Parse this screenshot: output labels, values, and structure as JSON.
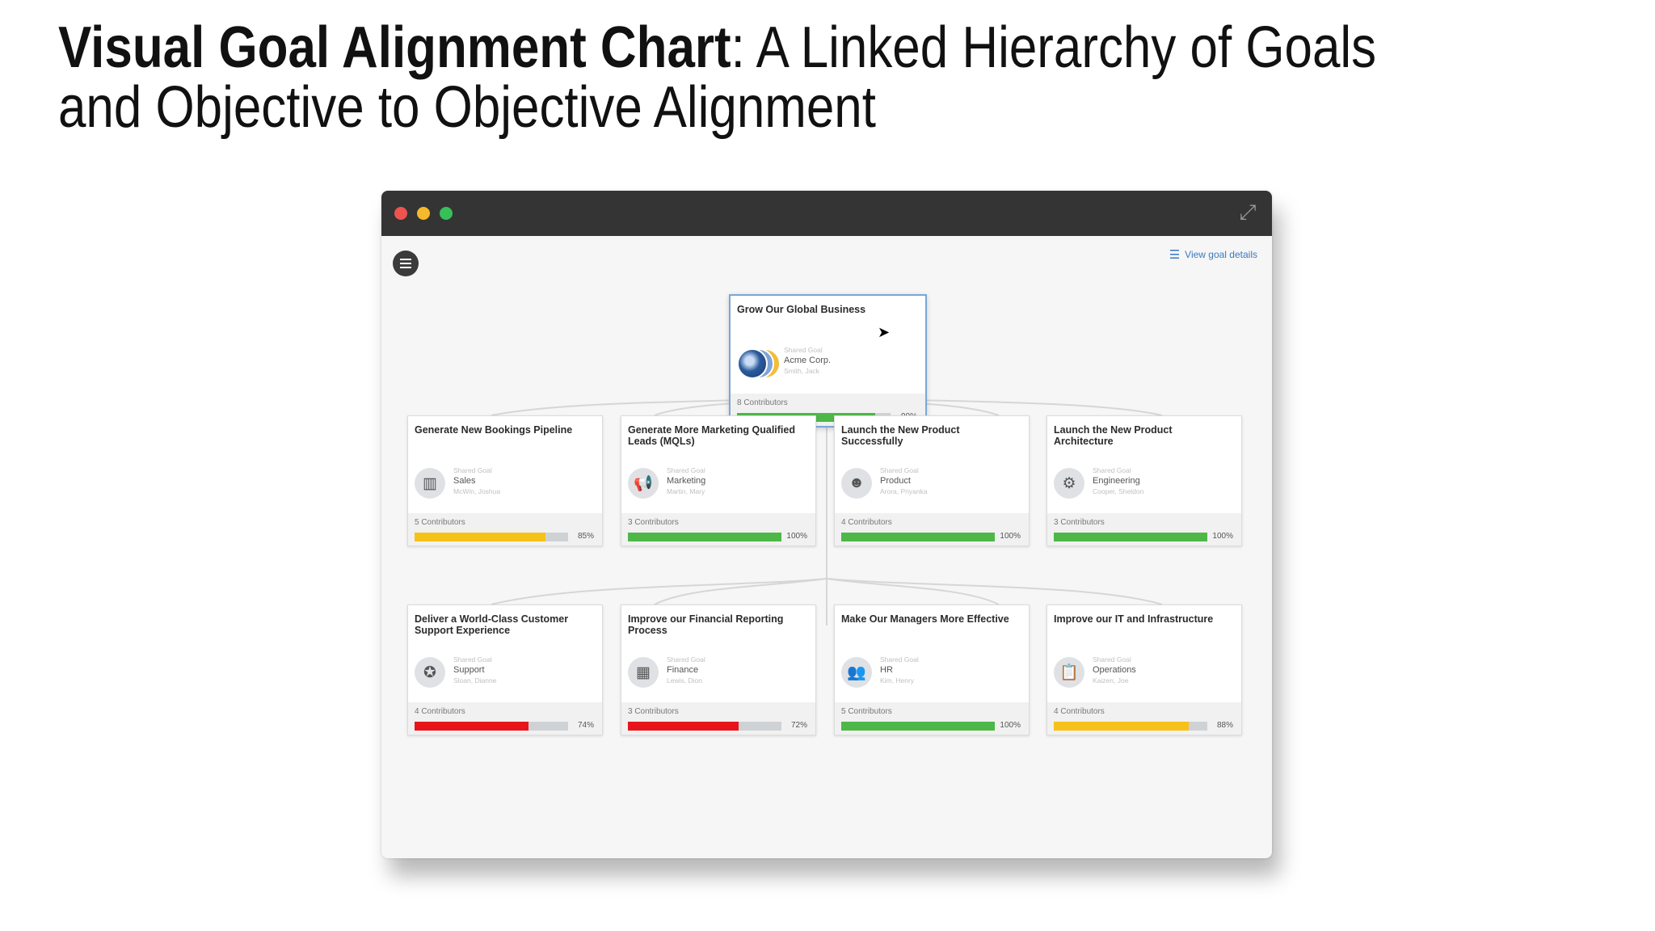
{
  "slide": {
    "title_bold": "Visual Goal Alignment Chart",
    "title_rest": ": A Linked Hierarchy of Goals and Objective to Objective Alignment"
  },
  "window": {
    "view_goal_details": "View goal details",
    "expand_icon": "expand-icon",
    "menu_icon": "hamburger-menu-icon"
  },
  "root_goal": {
    "title": "Grow Our Global Business",
    "shared_label": "Shared Goal",
    "team": "Acme Corp.",
    "owner": "Smith, Jack",
    "contributors": "8 Contributors",
    "progress_text": "90%",
    "progress": 0.9,
    "color": "#4db848"
  },
  "row1": [
    {
      "title": "Generate New Bookings Pipeline",
      "icon": "chart-icon",
      "glyph": "▥",
      "shared_label": "Shared Goal",
      "team": "Sales",
      "owner": "McWin, Joshua",
      "contributors": "5 Contributors",
      "progress_text": "85%",
      "progress": 0.85,
      "color": "#f6c219"
    },
    {
      "title": "Generate More Marketing Qualified Leads (MQLs)",
      "icon": "megaphone-icon",
      "glyph": "📢",
      "shared_label": "Shared Goal",
      "team": "Marketing",
      "owner": "Martin, Mary",
      "contributors": "3 Contributors",
      "progress_text": "100%",
      "progress": 1.0,
      "color": "#4db848"
    },
    {
      "title": "Launch the New Product Successfully",
      "icon": "lightbulb-head-icon",
      "glyph": "☻",
      "shared_label": "Shared Goal",
      "team": "Product",
      "owner": "Arora, Priyanka",
      "contributors": "4 Contributors",
      "progress_text": "100%",
      "progress": 1.0,
      "color": "#4db848"
    },
    {
      "title": "Launch the New Product Architecture",
      "icon": "gears-icon",
      "glyph": "⚙",
      "shared_label": "Shared Goal",
      "team": "Engineering",
      "owner": "Cooper, Sheldon",
      "contributors": "3 Contributors",
      "progress_text": "100%",
      "progress": 1.0,
      "color": "#4db848"
    }
  ],
  "row2": [
    {
      "title": "Deliver a World-Class Customer Support Experience",
      "icon": "support-badge-icon",
      "glyph": "✪",
      "shared_label": "Shared Goal",
      "team": "Support",
      "owner": "Sloan, Dianne",
      "contributors": "4 Contributors",
      "progress_text": "74%",
      "progress": 0.74,
      "color": "#e8141b"
    },
    {
      "title": "Improve our Financial Reporting Process",
      "icon": "calculator-icon",
      "glyph": "▦",
      "shared_label": "Shared Goal",
      "team": "Finance",
      "owner": "Lewis, Dion",
      "contributors": "3 Contributors",
      "progress_text": "72%",
      "progress": 0.72,
      "color": "#e8141b"
    },
    {
      "title": "Make Our Managers More Effective",
      "icon": "people-icon",
      "glyph": "👥",
      "shared_label": "Shared Goal",
      "team": "HR",
      "owner": "Kim, Henry",
      "contributors": "5 Contributors",
      "progress_text": "100%",
      "progress": 1.0,
      "color": "#4db848"
    },
    {
      "title": "Improve our IT and Infrastructure",
      "icon": "clipboard-icon",
      "glyph": "📋",
      "shared_label": "Shared Goal",
      "team": "Operations",
      "owner": "Kaizen, Joe",
      "contributors": "4 Contributors",
      "progress_text": "88%",
      "progress": 0.88,
      "color": "#f6c219"
    }
  ]
}
